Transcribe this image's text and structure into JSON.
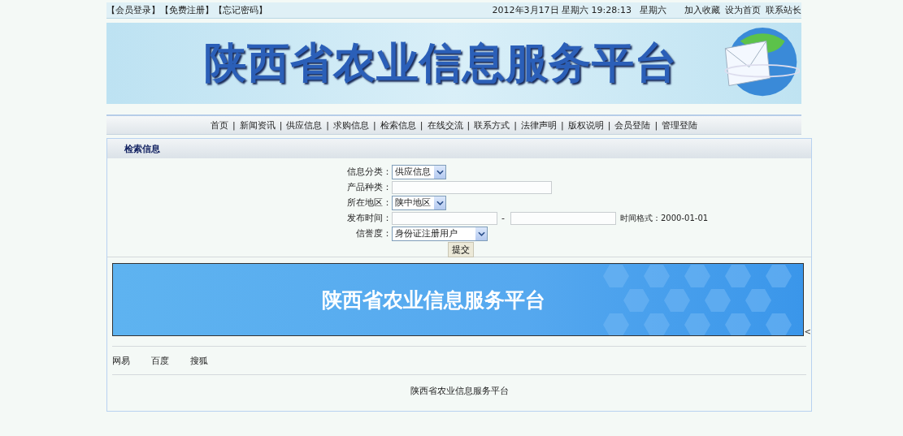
{
  "top_bar": {
    "links": [
      "【会员登录】",
      "【免费注册】",
      "【忘记密码】"
    ],
    "datetime": "2012年3月17日 星期六 19:28:13",
    "weekday": "星期六",
    "actions": [
      "加入收藏",
      "设为首页",
      "联系站长"
    ]
  },
  "header_banner": {
    "title": "陕西省农业信息服务平台"
  },
  "nav": {
    "items": [
      "首页",
      "新闻资讯",
      "供应信息",
      "求购信息",
      "检索信息",
      "在线交流",
      "联系方式",
      "法律声明",
      "版权说明",
      "会员登陆",
      "管理登陆"
    ],
    "separator": "|"
  },
  "panel": {
    "title": "检索信息",
    "form": [
      {
        "kind": "select",
        "label": "信息分类：",
        "value": "供应信息"
      },
      {
        "kind": "text",
        "label": "产品种类："
      },
      {
        "kind": "select",
        "label": "所在地区：",
        "value": "陕中地区"
      },
      {
        "kind": "range",
        "label": "发布时间：",
        "dash": "-",
        "hint": "时间格式：2000-01-01"
      },
      {
        "kind": "select",
        "label": "信誉度：",
        "value": "身份证注册用户"
      }
    ],
    "submit": "提交",
    "promo_banner": {
      "title": "陕西省农业信息服务平台"
    },
    "stray_mark": "<",
    "links": [
      "网易",
      "百度",
      "搜狐"
    ],
    "footer": "陕西省农业信息服务平台"
  }
}
